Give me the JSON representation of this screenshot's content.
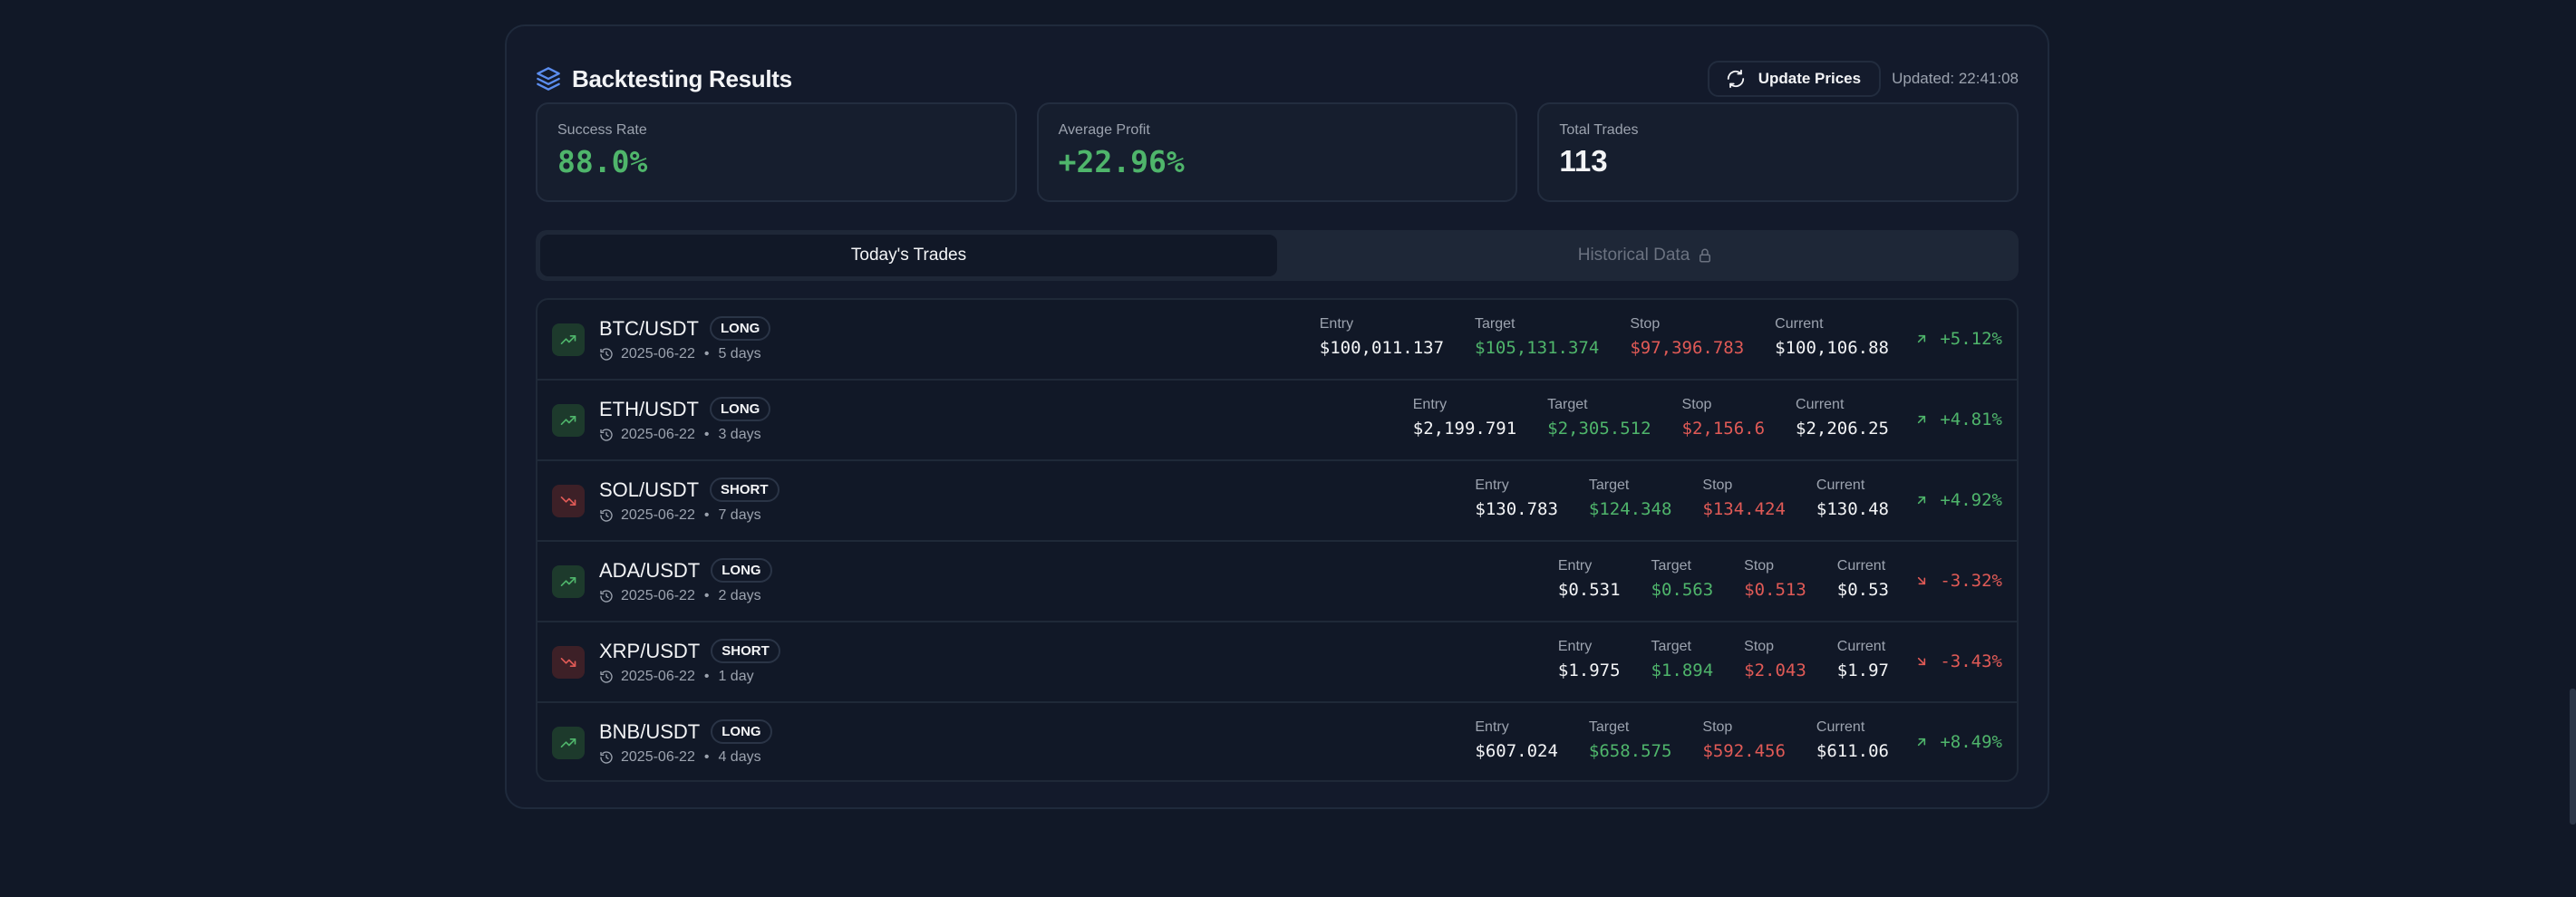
{
  "header": {
    "title": "Backtesting Results",
    "update_label": "Update Prices",
    "updated_text": "Updated: 22:41:08"
  },
  "stats": {
    "success_rate": {
      "label": "Success Rate",
      "value": "88.0%"
    },
    "average_profit": {
      "label": "Average Profit",
      "value": "+22.96%"
    },
    "total_trades": {
      "label": "Total Trades",
      "value": "113"
    }
  },
  "tabs": {
    "today": "Today's Trades",
    "historical": "Historical Data"
  },
  "columns": {
    "entry": "Entry",
    "target": "Target",
    "stop": "Stop",
    "current": "Current"
  },
  "trades": [
    {
      "pair": "BTC/USDT",
      "side": "LONG",
      "date": "2025-06-22",
      "duration": "5 days",
      "entry": "$100,011.137",
      "target": "$105,131.374",
      "stop": "$97,396.783",
      "current": "$100,106.88",
      "change": "+5.12%",
      "trend": "up",
      "change_dir": "up"
    },
    {
      "pair": "ETH/USDT",
      "side": "LONG",
      "date": "2025-06-22",
      "duration": "3 days",
      "entry": "$2,199.791",
      "target": "$2,305.512",
      "stop": "$2,156.6",
      "current": "$2,206.25",
      "change": "+4.81%",
      "trend": "up",
      "change_dir": "up"
    },
    {
      "pair": "SOL/USDT",
      "side": "SHORT",
      "date": "2025-06-22",
      "duration": "7 days",
      "entry": "$130.783",
      "target": "$124.348",
      "stop": "$134.424",
      "current": "$130.48",
      "change": "+4.92%",
      "trend": "down",
      "change_dir": "up"
    },
    {
      "pair": "ADA/USDT",
      "side": "LONG",
      "date": "2025-06-22",
      "duration": "2 days",
      "entry": "$0.531",
      "target": "$0.563",
      "stop": "$0.513",
      "current": "$0.53",
      "change": "-3.32%",
      "trend": "up",
      "change_dir": "down"
    },
    {
      "pair": "XRP/USDT",
      "side": "SHORT",
      "date": "2025-06-22",
      "duration": "1 day",
      "entry": "$1.975",
      "target": "$1.894",
      "stop": "$2.043",
      "current": "$1.97",
      "change": "-3.43%",
      "trend": "down",
      "change_dir": "down"
    },
    {
      "pair": "BNB/USDT",
      "side": "LONG",
      "date": "2025-06-22",
      "duration": "4 days",
      "entry": "$607.024",
      "target": "$658.575",
      "stop": "$592.456",
      "current": "$611.06",
      "change": "+8.49%",
      "trend": "up",
      "change_dir": "up"
    }
  ],
  "colors": {
    "background": "#111827",
    "positive": "#4fb56b",
    "negative": "#e05a56",
    "accent": "#5b8def"
  },
  "icons": {
    "title": "layers-icon",
    "update": "refresh-icon",
    "lock": "lock-icon",
    "trend_up": "trending-up-icon",
    "trend_down": "trending-down-icon",
    "clock": "clock-icon",
    "arrow_up": "arrow-up-right-icon",
    "arrow_down": "arrow-down-right-icon"
  }
}
